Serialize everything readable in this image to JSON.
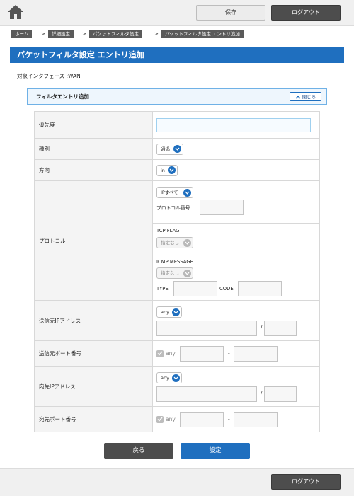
{
  "header": {
    "save_label": "保存",
    "logout_label": "ログアウト"
  },
  "breadcrumb": [
    "ホーム",
    "詳細設定",
    "パケットフィルタ設定",
    "パケットフィルタ設定 エントリ追加"
  ],
  "breadcrumb_sep": ">",
  "page_title": "パケットフィルタ設定 エントリ追加",
  "interface_text": "対象インタフェース :WAN",
  "panel": {
    "title": "フィルタエントリ追加",
    "collapse_label": "閉じる"
  },
  "form": {
    "priority": {
      "label": "優先度",
      "value": ""
    },
    "type": {
      "label": "種別",
      "selected": "通過"
    },
    "direction": {
      "label": "方向",
      "selected": "in"
    },
    "protocol": {
      "label": "プロトコル",
      "selected": "IPすべて",
      "number_label": "プロトコル番号",
      "tcp_flag_label": "TCP FLAG",
      "tcp_flag_selected": "指定なし",
      "icmp_label": "ICMP MESSAGE",
      "icmp_selected": "指定なし",
      "type_label": "TYPE",
      "code_label": "CODE"
    },
    "src_ip": {
      "label": "送信元IPアドレス",
      "selected": "any",
      "slash": "/"
    },
    "src_port": {
      "label": "送信元ポート番号",
      "any_label": "any",
      "dash": "-"
    },
    "dst_ip": {
      "label": "宛先IPアドレス",
      "selected": "any",
      "slash": "/"
    },
    "dst_port": {
      "label": "宛先ポート番号",
      "any_label": "any",
      "dash": "-"
    }
  },
  "actions": {
    "back_label": "戻る",
    "set_label": "設定"
  },
  "footer": {
    "logout_label": "ログアウト"
  },
  "colors": {
    "primary": "#1f6fbf",
    "dark_button": "#4d4d4d",
    "panel_border": "#6fb1e6"
  },
  "icons": {
    "home": "home-icon",
    "chevron": "chevron-down-icon",
    "check": "check-icon",
    "collapse": "chevron-up-icon"
  }
}
